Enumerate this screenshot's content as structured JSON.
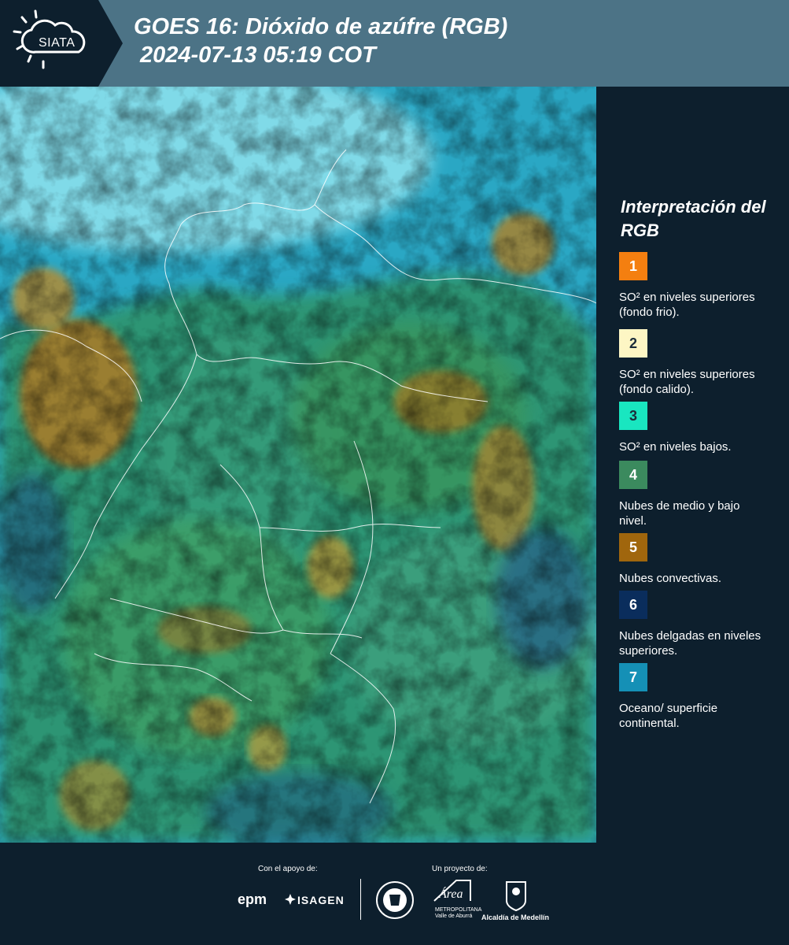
{
  "header": {
    "brand": "SIATA",
    "title_line1": "GOES 16: Dióxido de azúfre (RGB)",
    "title_line2": "2024-07-13 05:19 COT"
  },
  "legend": {
    "title": "Interpretación del RGB",
    "items": [
      {
        "number": "1",
        "color": "#f47f10",
        "text_color": "#ffffff",
        "label": "SO² en niveles superiores (fondo frio)."
      },
      {
        "number": "2",
        "color": "#fdf6c4",
        "text_color": "#1c2d3a",
        "label": "SO² en niveles superiores (fondo calido)."
      },
      {
        "number": "3",
        "color": "#19e6c0",
        "text_color": "#1c2d3a",
        "label": "SO² en niveles bajos."
      },
      {
        "number": "4",
        "color": "#3b8a5e",
        "text_color": "#ffffff",
        "label": "Nubes de medio y bajo nivel."
      },
      {
        "number": "5",
        "color": "#a0660d",
        "text_color": "#ffffff",
        "label": "Nubes convectivas."
      },
      {
        "number": "6",
        "color": "#0a2d5c",
        "text_color": "#ffffff",
        "label": "Nubes delgadas en niveles superiores."
      },
      {
        "number": "7",
        "color": "#1590b6",
        "text_color": "#ffffff",
        "label": "Oceano/ superficie continental."
      }
    ]
  },
  "footer": {
    "support_label": "Con el apoyo de:",
    "project_label": "Un proyecto de:",
    "epm": "epm",
    "isagen": "ISAGEN",
    "area_logo": "Área",
    "area_line1": "METROPOLITANA",
    "area_line2": "Valle de Aburrá",
    "alcaldia": "Alcaldía de Medellín"
  },
  "colors": {
    "header_bg": "#4c7386",
    "page_bg": "#0d1f2d"
  }
}
